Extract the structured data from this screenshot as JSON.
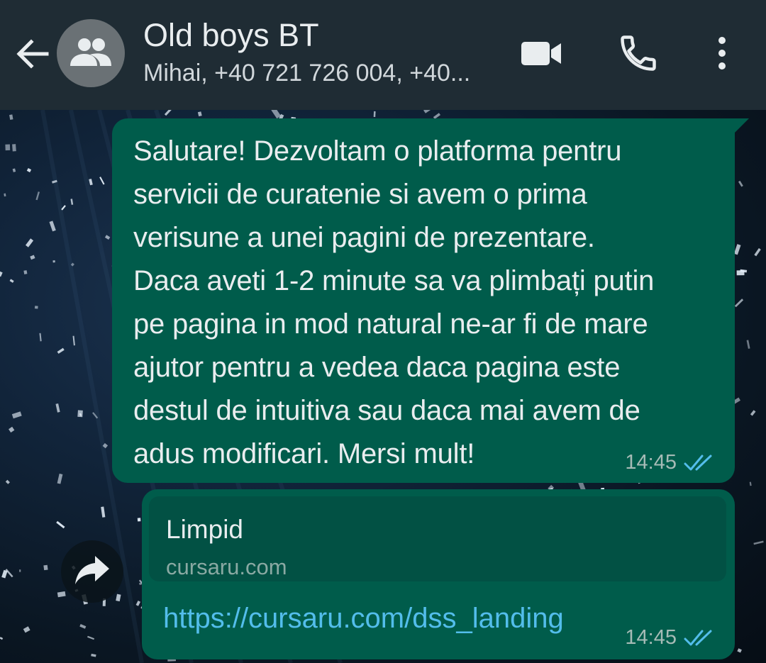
{
  "header": {
    "title": "Old boys BT",
    "subtitle": "Mihai, +40 721 726 004, +40...",
    "icons": {
      "back": "arrow-left-icon",
      "avatar": "group-icon",
      "video": "video-camera-icon",
      "call": "phone-icon",
      "menu": "more-vertical-icon"
    }
  },
  "messages": [
    {
      "text": "Salutare! Dezvoltam o platforma pentru\nservicii de curatenie si avem o prima\nverisune a unei pagini de prezentare.\nDaca aveti 1-2 minute sa va plimbați putin\npe pagina in mod natural ne-ar fi de mare\najutor pentru a vedea daca pagina este\ndestul de intuitiva sau daca mai avem de\nadus modificari. Mersi mult!",
      "time": "14:45",
      "status_icon": "double-check-icon"
    },
    {
      "preview_title": "Limpid",
      "preview_domain": "cursaru.com",
      "link": "https://cursaru.com/dss_landing",
      "time": "14:45",
      "status_icon": "double-check-icon"
    }
  ],
  "forward_icon": "forward-arrow-icon",
  "colors": {
    "header_bg": "#1f2c34",
    "bubble_out": "#005c4b",
    "preview_bg": "#025144",
    "link": "#53bdeb",
    "check_read": "#53bdeb"
  }
}
